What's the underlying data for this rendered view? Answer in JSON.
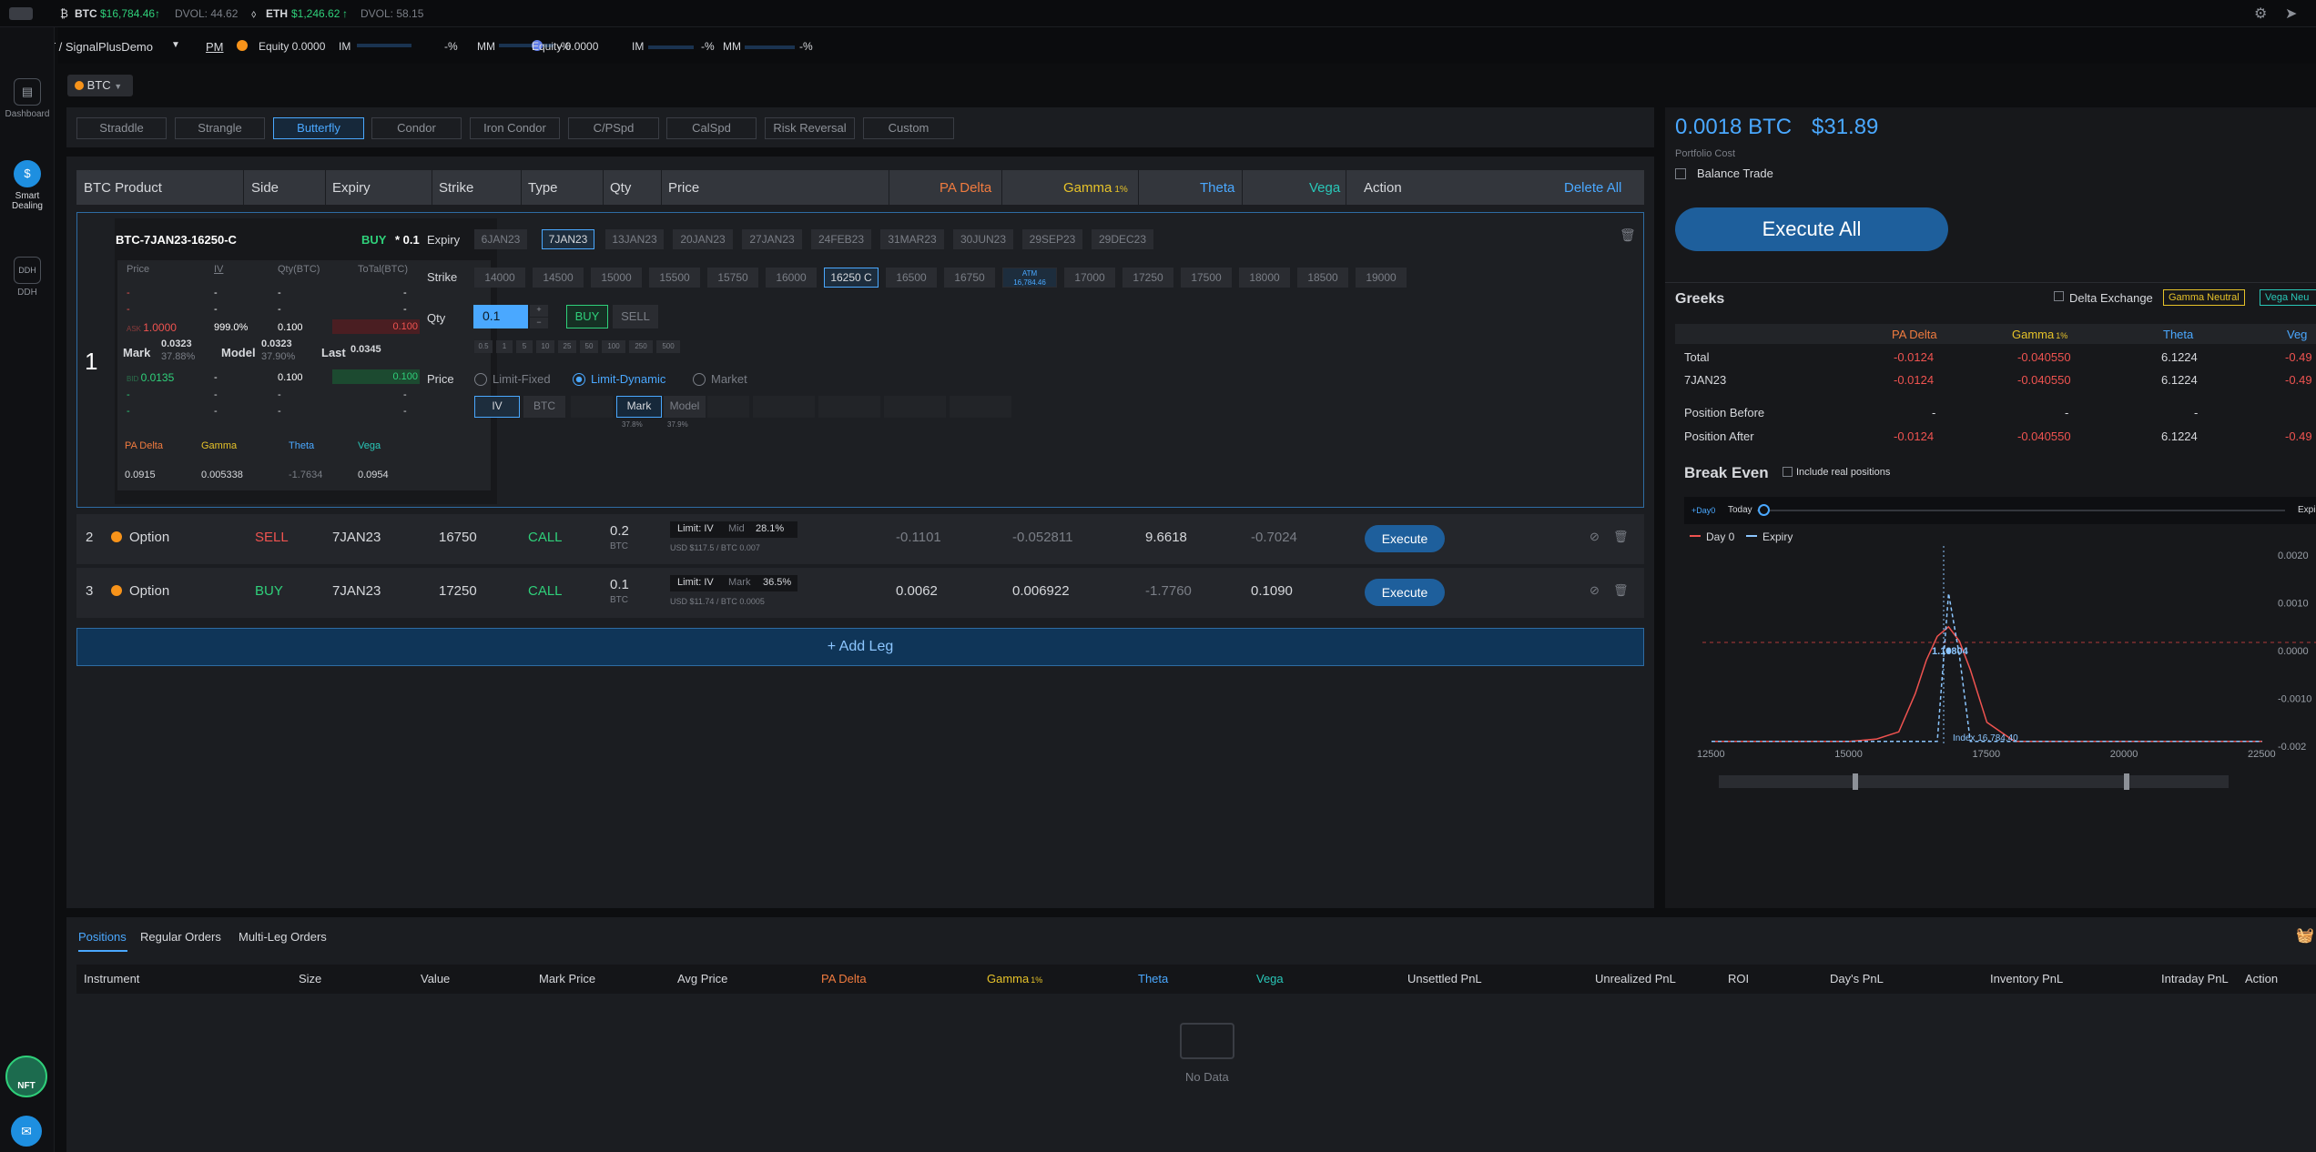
{
  "ticker": {
    "btc_label": "BTC",
    "btc_price": "$16,784.46",
    "btc_dvol": "DVOL: 44.62",
    "eth_label": "ETH",
    "eth_price": "$1,246.62",
    "eth_dvol": "DVOL: 58.15"
  },
  "account": {
    "name": "DERIBIT / SignalPlusDemo",
    "pm": "PM",
    "equity1": "Equity 0.0000",
    "im1": "IM",
    "im1_val": "-%",
    "mm1": "MM",
    "mm1_val": "-%",
    "equity2": "Equity 0.0000",
    "im2": "IM",
    "im2_val": "-%",
    "mm2": "MM",
    "mm2_val": "-%"
  },
  "sidebar": {
    "items": [
      {
        "label": "Dashboard",
        "icon": "dashboard-icon"
      },
      {
        "label": "Smart Dealing",
        "icon": "dollar-icon"
      },
      {
        "label": "DDH",
        "icon": "ddh-icon"
      }
    ],
    "nft": "NFT"
  },
  "asset_select": "BTC",
  "strategies": [
    "Straddle",
    "Strangle",
    "Butterfly",
    "Condor",
    "Iron Condor",
    "C/PSpd",
    "CalSpd",
    "Risk Reversal",
    "Custom"
  ],
  "table_headers": {
    "product": "BTC Product",
    "side": "Side",
    "expiry": "Expiry",
    "strike": "Strike",
    "type": "Type",
    "qty": "Qty",
    "price": "Price",
    "pa_delta": "PA Delta",
    "gamma": "Gamma",
    "gamma_sub": "1%",
    "theta": "Theta",
    "vega": "Vega",
    "action": "Action",
    "delete_all": "Delete All"
  },
  "leg1": {
    "num": "1",
    "instrument": "BTC-7JAN23-16250-C",
    "side": "BUY",
    "qty_badge": "* 0.1",
    "book_head": [
      "Price",
      "IV",
      "Qty(BTC)",
      "ToTal(BTC)"
    ],
    "ask_price": "1.0000",
    "ask_iv": "999.0%",
    "ask_qty": "0.100",
    "ask_total": "0.100",
    "mark_label": "Mark",
    "mark_val": "0.0323",
    "mark_iv": "37.88%",
    "model_label": "Model",
    "model_val": "0.0323",
    "model_iv": "37.90%",
    "last_label": "Last",
    "last_val": "0.0345",
    "bid_price": "0.0135",
    "bid_qty": "0.100",
    "bid_total": "0.100",
    "greek_heads": [
      "PA Delta",
      "Gamma",
      "Theta",
      "Vega"
    ],
    "greek_vals": [
      "0.0915",
      "0.005338",
      "-1.7634",
      "0.0954"
    ],
    "expiry_label": "Expiry",
    "expiries": [
      "6JAN23",
      "7JAN23",
      "13JAN23",
      "20JAN23",
      "27JAN23",
      "24FEB23",
      "31MAR23",
      "30JUN23",
      "29SEP23",
      "29DEC23"
    ],
    "strike_label": "Strike",
    "strikes": [
      "14000",
      "14500",
      "15000",
      "15500",
      "15750",
      "16000",
      "16250 C",
      "16500",
      "16750",
      "ATM",
      "17000",
      "17250",
      "17500",
      "18000",
      "18500",
      "19000"
    ],
    "atm_sub": "16,784.46",
    "qty_label": "Qty",
    "qty_value": "0.1",
    "buy": "BUY",
    "sell": "SELL",
    "qty_presets": [
      "0.5",
      "1",
      "5",
      "10",
      "25",
      "50",
      "100",
      "250",
      "500"
    ],
    "price_label": "Price",
    "price_modes": [
      "Limit-Fixed",
      "Limit-Dynamic",
      "Market"
    ],
    "price_sub": [
      "IV",
      "BTC"
    ],
    "price_ref": [
      "Mark",
      "Model"
    ],
    "mark_pct": "37.8%",
    "model_pct": "37.9%"
  },
  "legs": [
    {
      "num": "2",
      "product": "Option",
      "side": "SELL",
      "expiry": "7JAN23",
      "strike": "16750",
      "type": "CALL",
      "qty": "0.2",
      "qty_unit": "BTC",
      "limit": "Limit: IV",
      "ref": "Mid",
      "ref_val": "28.1%",
      "sub": "USD $117.5 / BTC 0.007",
      "pa_delta": "-0.1101",
      "gamma": "-0.052811",
      "theta": "9.6618",
      "vega": "-0.7024",
      "action": "Execute"
    },
    {
      "num": "3",
      "product": "Option",
      "side": "BUY",
      "expiry": "7JAN23",
      "strike": "17250",
      "type": "CALL",
      "qty": "0.1",
      "qty_unit": "BTC",
      "limit": "Limit: IV",
      "ref": "Mark",
      "ref_val": "36.5%",
      "sub": "USD $11.74 / BTC 0.0005",
      "pa_delta": "0.0062",
      "gamma": "0.006922",
      "theta": "-1.7760",
      "vega": "0.1090",
      "action": "Execute"
    }
  ],
  "add_leg": "+ Add Leg",
  "right": {
    "cost_btc": "0.0018 BTC",
    "cost_usd": "$31.89",
    "portfolio_cost": "Portfolio Cost",
    "balance_trade": "Balance Trade",
    "execute_all": "Execute All",
    "greeks_title": "Greeks",
    "delta_exchange": "Delta Exchange",
    "gamma_neutral": "Gamma Neutral",
    "vega_neutral": "Vega Neu",
    "gh": [
      "PA Delta",
      "Gamma",
      "Theta",
      "Veg"
    ],
    "gamma_sub": "1%",
    "rows": [
      {
        "label": "Total",
        "v": [
          "-0.0124",
          "-0.040550",
          "6.1224",
          "-0.49"
        ]
      },
      {
        "label": "7JAN23",
        "v": [
          "-0.0124",
          "-0.040550",
          "6.1224",
          "-0.49"
        ]
      },
      {
        "label": "Position Before",
        "v": [
          "-",
          "-",
          "-",
          ""
        ]
      },
      {
        "label": "Position After",
        "v": [
          "-0.0124",
          "-0.040550",
          "6.1224",
          "-0.49"
        ]
      }
    ],
    "break_even": "Break Even",
    "include_real": "Include real positions",
    "day_chip": "+Day0",
    "today": "Today",
    "expiry_end": "Expir",
    "legend_day0": "Day 0",
    "legend_expiry": "Expiry",
    "be_label": "16804",
    "index_label": "Index 16,784.40",
    "y_ticks": [
      "0.0020",
      "0.0010",
      "0.0000",
      "-0.0010",
      "-0.002"
    ],
    "x_ticks": [
      "12500",
      "15000",
      "17500",
      "20000",
      "22500"
    ]
  },
  "bottom": {
    "tabs": [
      "Positions",
      "Regular Orders",
      "Multi-Leg Orders"
    ],
    "headers": [
      "Instrument",
      "Size",
      "Value",
      "Mark Price",
      "Avg Price",
      "PA Delta",
      "Gamma",
      "Theta",
      "Vega",
      "Unsettled PnL",
      "Unrealized PnL",
      "ROI",
      "Day's PnL",
      "Inventory PnL",
      "Intraday PnL",
      "Action"
    ],
    "gamma_sub": "1%",
    "no_data": "No Data"
  },
  "chart_data": {
    "type": "line",
    "x": [
      12500,
      14000,
      15000,
      15500,
      15900,
      16200,
      16400,
      16600,
      16804,
      17000,
      17200,
      17500,
      18000,
      19000,
      20000,
      21000,
      22500
    ],
    "series": [
      {
        "name": "Day 0",
        "values": [
          -0.0019,
          -0.0019,
          -0.0019,
          -0.00185,
          -0.0017,
          -0.0009,
          -0.0002,
          0.0003,
          0.0005,
          0.0002,
          -0.0004,
          -0.0015,
          -0.0019,
          -0.0019,
          -0.0019,
          -0.0019,
          -0.0019
        ]
      },
      {
        "name": "Expiry",
        "values": [
          -0.0019,
          -0.0019,
          -0.0019,
          -0.0019,
          -0.0019,
          -0.0019,
          -0.0019,
          -0.0019,
          0.0012,
          -0.0001,
          -0.0019,
          -0.0019,
          -0.0019,
          -0.0019,
          -0.0019,
          -0.0019,
          -0.0019
        ]
      }
    ],
    "xlim": [
      12500,
      22500
    ],
    "ylim": [
      -0.002,
      0.002
    ]
  }
}
